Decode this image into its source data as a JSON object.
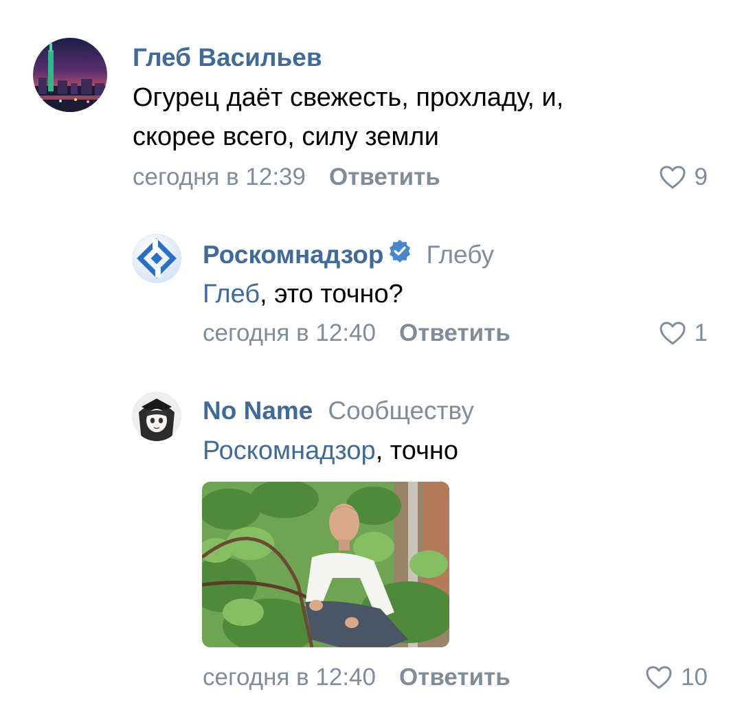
{
  "comments": [
    {
      "author": "Глеб Васильев",
      "text_line1": "Огурец даёт свежесть, прохладу, и,",
      "text_line2": "скорее всего, силу земли",
      "time": "сегодня в 12:39",
      "reply_label": "Ответить",
      "likes": "9",
      "avatar_icon": "night-city-avatar"
    },
    {
      "author": "Роскомнадзор",
      "reply_to": "Глебу",
      "mention": "Глеб",
      "text_rest": ", это точно?",
      "time": "сегодня в 12:40",
      "reply_label": "Ответить",
      "likes": "1",
      "verified_icon": "verified-badge-icon",
      "avatar_icon": "roskomnadzor-logo"
    },
    {
      "author": "No Name",
      "reply_to": "Сообществу",
      "mention": "Роскомнадзор",
      "text_rest": ", точно",
      "time": "сегодня в 12:40",
      "reply_label": "Ответить",
      "likes": "10",
      "avatar_icon": "anime-girl-avatar",
      "attachment": "photo-man-in-cucumber-garden"
    }
  ],
  "colors": {
    "link": "#3f6a99",
    "secondary": "#818c99",
    "verified": "#4986cc",
    "text": "#000000"
  }
}
